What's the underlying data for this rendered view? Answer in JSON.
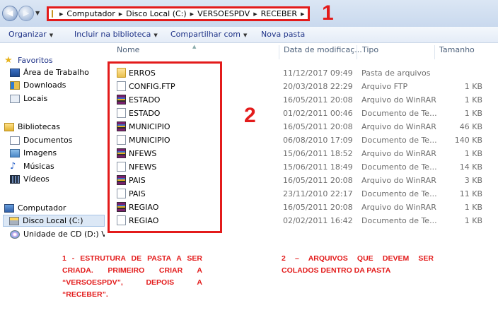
{
  "address": {
    "crumbs": [
      "Computador",
      "Disco Local (C:)",
      "VERSOESPDV",
      "RECEBER"
    ],
    "annotation_number": "1"
  },
  "toolbar": {
    "organize": "Organizar",
    "include": "Incluir na biblioteca",
    "share": "Compartilhar com",
    "new_folder": "Nova pasta"
  },
  "nav": {
    "favorites": "Favoritos",
    "desktop": "Área de Trabalho",
    "downloads": "Downloads",
    "places": "Locais",
    "libraries": "Bibliotecas",
    "documents": "Documentos",
    "images": "Imagens",
    "music": "Músicas",
    "videos": "Vídeos",
    "computer": "Computador",
    "local_disk": "Disco Local (C:)",
    "cd_drive": "Unidade de CD (D:) V"
  },
  "columns": {
    "name": "Nome",
    "date": "Data de modificaç...",
    "type": "Tipo",
    "size": "Tamanho"
  },
  "files": [
    {
      "name": "ERROS",
      "icon": "folder-icon",
      "date": "11/12/2017 09:49",
      "type": "Pasta de arquivos",
      "size": ""
    },
    {
      "name": "CONFIG.FTP",
      "icon": "document-icon",
      "date": "20/03/2018 22:29",
      "type": "Arquivo FTP",
      "size": "1 KB"
    },
    {
      "name": "ESTADO",
      "icon": "winrar-icon",
      "date": "16/05/2011 20:08",
      "type": "Arquivo do WinRAR",
      "size": "1 KB"
    },
    {
      "name": "ESTADO",
      "icon": "document-icon",
      "date": "01/02/2011 00:46",
      "type": "Documento de Te...",
      "size": "1 KB"
    },
    {
      "name": "MUNICIPIO",
      "icon": "winrar-icon",
      "date": "16/05/2011 20:08",
      "type": "Arquivo do WinRAR",
      "size": "46 KB"
    },
    {
      "name": "MUNICIPIO",
      "icon": "document-icon",
      "date": "06/08/2010 17:09",
      "type": "Documento de Te...",
      "size": "140 KB"
    },
    {
      "name": "NFEWS",
      "icon": "winrar-icon",
      "date": "15/06/2011 18:52",
      "type": "Arquivo do WinRAR",
      "size": "1 KB"
    },
    {
      "name": "NFEWS",
      "icon": "document-icon",
      "date": "15/06/2011 18:49",
      "type": "Documento de Te...",
      "size": "14 KB"
    },
    {
      "name": "PAIS",
      "icon": "winrar-icon",
      "date": "16/05/2011 20:08",
      "type": "Arquivo do WinRAR",
      "size": "3 KB"
    },
    {
      "name": "PAIS",
      "icon": "document-icon",
      "date": "23/11/2010 22:17",
      "type": "Documento de Te...",
      "size": "11 KB"
    },
    {
      "name": "REGIAO",
      "icon": "winrar-icon",
      "date": "16/05/2011 20:08",
      "type": "Arquivo do WinRAR",
      "size": "1 KB"
    },
    {
      "name": "REGIAO",
      "icon": "document-icon",
      "date": "02/02/2011 16:42",
      "type": "Documento de Te...",
      "size": "1 KB"
    }
  ],
  "annotation_2": "2",
  "notes": {
    "note1": "1 - ESTRUTURA DE PASTA A SER CRIADA. PRIMEIRO CRIAR A “VERSOESPDV”, DEPOIS A “RECEBER”.",
    "note2": "2 – ARQUIVOS QUE DEVEM SER COLADOS DENTRO DA PASTA"
  },
  "colors": {
    "annotation_red": "#e31b1b",
    "toolbar_text": "#1e3287",
    "secondary_text": "#6d6d6d"
  }
}
